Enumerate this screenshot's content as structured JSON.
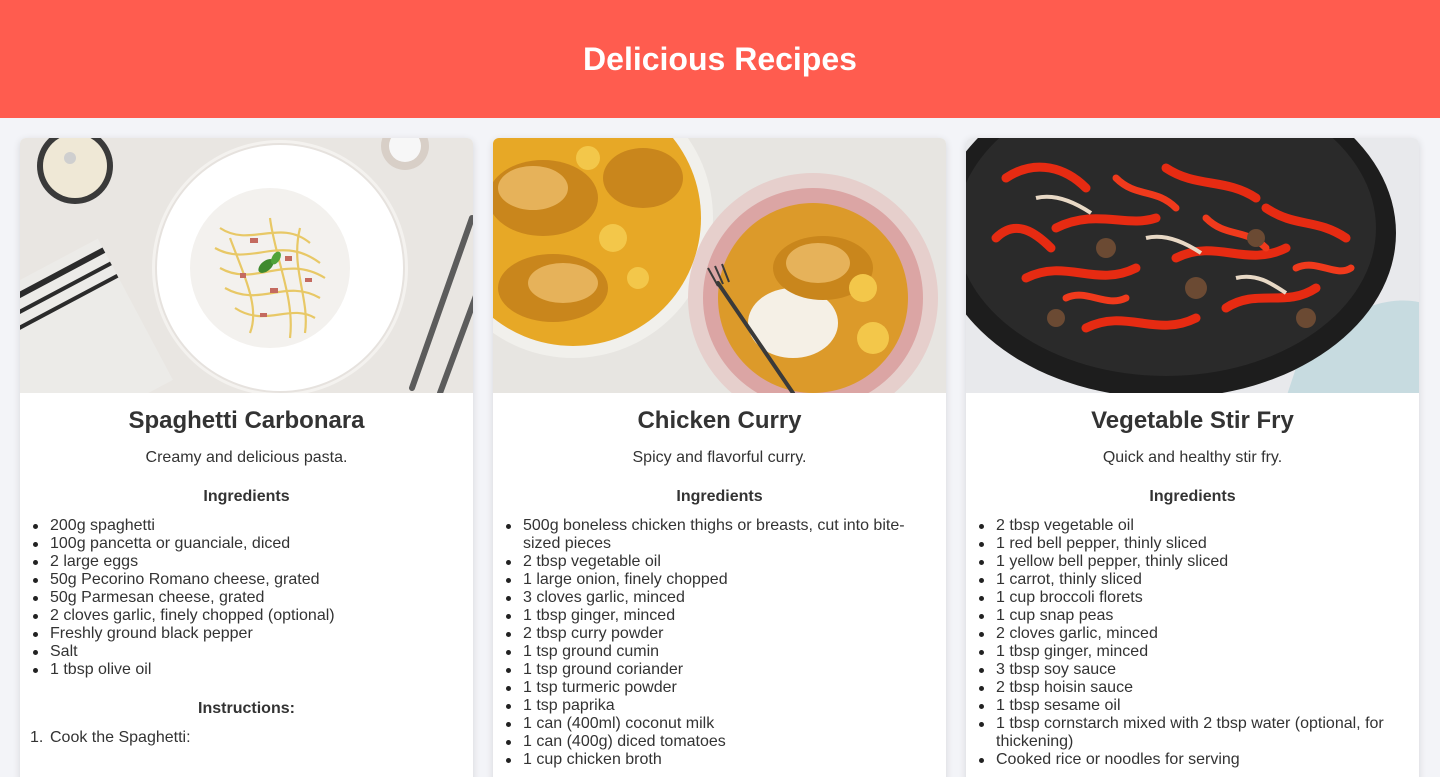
{
  "header": {
    "title": "Delicious Recipes"
  },
  "colors": {
    "header_bg": "#ff5c4f",
    "page_bg": "#f3f4f8",
    "text": "#333333"
  },
  "recipes": [
    {
      "image": "carbonara-photo",
      "title": "Spaghetti Carbonara",
      "description": "Creamy and delicious pasta.",
      "ingredients_heading": "Ingredients",
      "ingredients": [
        "200g spaghetti",
        "100g pancetta or guanciale, diced",
        "2 large eggs",
        "50g Pecorino Romano cheese, grated",
        "50g Parmesan cheese, grated",
        "2 cloves garlic, finely chopped (optional)",
        "Freshly ground black pepper",
        "Salt",
        "1 tbsp olive oil"
      ],
      "instructions_heading": "Instructions:",
      "steps": [
        {
          "num": "1.",
          "text": "Cook the Spaghetti:"
        }
      ]
    },
    {
      "image": "curry-photo",
      "title": "Chicken Curry",
      "description": "Spicy and flavorful curry.",
      "ingredients_heading": "Ingredients",
      "ingredients": [
        "500g boneless chicken thighs or breasts, cut into bite-sized pieces",
        "2 tbsp vegetable oil",
        "1 large onion, finely chopped",
        "3 cloves garlic, minced",
        "1 tbsp ginger, minced",
        "2 tbsp curry powder",
        "1 tsp ground cumin",
        "1 tsp ground coriander",
        "1 tsp turmeric powder",
        "1 tsp paprika",
        "1 can (400ml) coconut milk",
        "1 can (400g) diced tomatoes",
        "1 cup chicken broth"
      ]
    },
    {
      "image": "stirfry-photo",
      "title": "Vegetable Stir Fry",
      "description": "Quick and healthy stir fry.",
      "ingredients_heading": "Ingredients",
      "ingredients": [
        "2 tbsp vegetable oil",
        "1 red bell pepper, thinly sliced",
        "1 yellow bell pepper, thinly sliced",
        "1 carrot, thinly sliced",
        "1 cup broccoli florets",
        "1 cup snap peas",
        "2 cloves garlic, minced",
        "1 tbsp ginger, minced",
        "3 tbsp soy sauce",
        "2 tbsp hoisin sauce",
        "1 tbsp sesame oil",
        "1 tbsp cornstarch mixed with 2 tbsp water (optional, for thickening)",
        "Cooked rice or noodles for serving"
      ]
    }
  ]
}
